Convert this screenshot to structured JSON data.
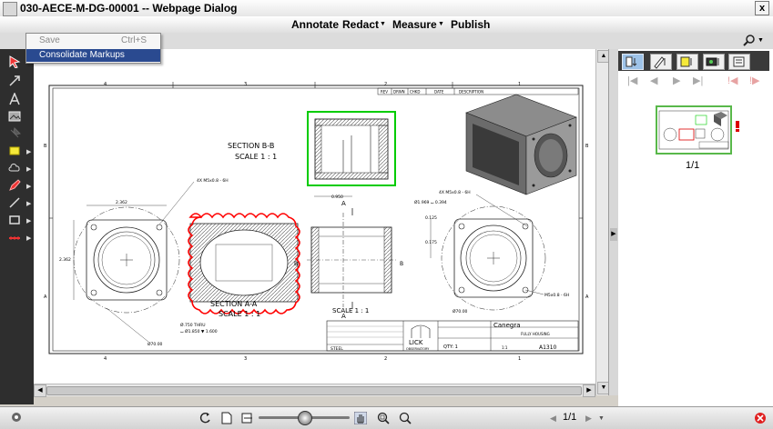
{
  "window": {
    "title": "030-AECE-M-DG-00001 -- Webpage Dialog",
    "close_glyph": "x"
  },
  "menubar": {
    "items": [
      {
        "label": "Annotate",
        "name": "menu-annotate"
      },
      {
        "label": "Redact",
        "arrow": "▼",
        "name": "menu-redact"
      },
      {
        "label": "Measure",
        "arrow": "▼",
        "name": "menu-measure"
      },
      {
        "label": "Publish",
        "name": "menu-publish"
      }
    ]
  },
  "file_menu": {
    "save_label": "Save",
    "save_shortcut": "Ctrl+S",
    "consolidate_label": "Consolidate Markups"
  },
  "search": {
    "value": ""
  },
  "colors": {
    "accent": "#2a4a90",
    "thumb_border": "#59b84a",
    "markup_red": "#ff0000",
    "section_green": "#00cc00"
  },
  "drawing": {
    "border_numbers_top": [
      "4",
      "3",
      "2",
      "1"
    ],
    "border_numbers_bottom": [
      "4",
      "3",
      "2",
      "1"
    ],
    "border_letters": [
      "B",
      "A"
    ],
    "rev_header": [
      "REV",
      "DRWN",
      "CHKD",
      "DATE",
      "DESCRIPTION"
    ],
    "section_bb_title": "SECTION  B-B",
    "section_bb_scale": "SCALE 1 : 1",
    "section_aa_title": "SECTION  A-A",
    "section_aa_scale": "SCALE 1 : 1",
    "side_scale": "SCALE 1 : 1",
    "hole_note_left": "4X M5x0.8 - 6H",
    "hole_note_right": "4X M5x0.8 - 6H",
    "hole_note_right2": "M5x0.8 - 6H",
    "dim_width": "2.362",
    "dim_height": "2.362",
    "dim_950": "0.950",
    "dim_counterbore": "Ø1.969 ⌴ 0.394",
    "dim_125": "0.125",
    "dim_175": "0.175",
    "dim_thru": "Ø.750 THRU",
    "dim_cbore": "⌴ Ø1.850 ▼ 1.600",
    "dim_dia_left": "Ø70.00",
    "dim_dia_right": "Ø70.00",
    "label_a_top": "A",
    "label_a_bottom": "A",
    "label_b_left": "B",
    "label_b_right": "B",
    "company": "LICK",
    "company_sub": "OBSERVATORY",
    "brand": "Canegra",
    "part_name": "FULLY HOUSING",
    "dwg_no": "A1310",
    "qty": "QTY: 1",
    "material": "STEEL",
    "sheet_scale": "1:1"
  },
  "right_panel": {
    "page_count": "1/1"
  },
  "bottom": {
    "page_value": "1/1",
    "zoom_pct": 0.5
  }
}
